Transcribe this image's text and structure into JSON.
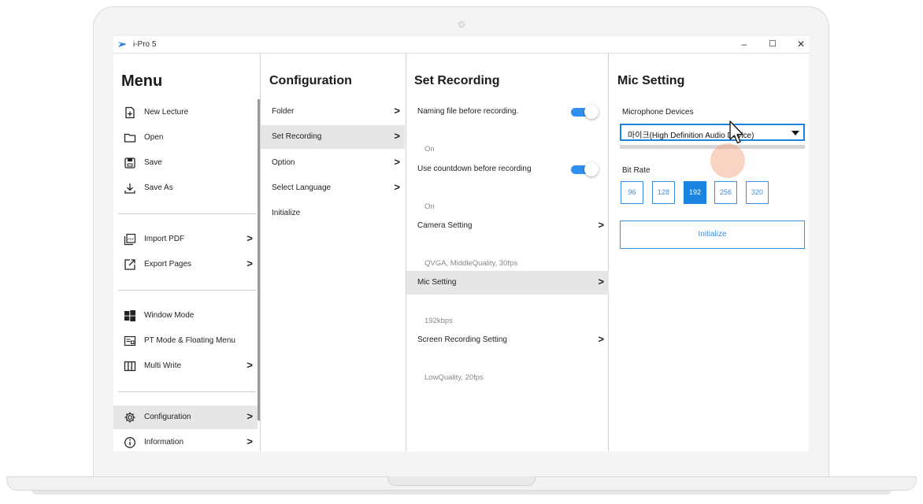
{
  "app": {
    "title": "i-Pro 5",
    "logo_icon": "ipro-logo-icon",
    "controls": {
      "minimize": "–",
      "maximize": "☐",
      "close": "✕"
    }
  },
  "menu": {
    "title": "Menu",
    "items": [
      {
        "label": "New Lecture",
        "icon": "new-file-icon"
      },
      {
        "label": "Open",
        "icon": "folder-icon"
      },
      {
        "label": "Save",
        "icon": "save-icon"
      },
      {
        "label": "Save As",
        "icon": "download-icon"
      },
      {
        "label": "Import PDF",
        "icon": "pdf-icon",
        "chevron": ">"
      },
      {
        "label": "Export Pages",
        "icon": "export-icon",
        "chevron": ">"
      },
      {
        "label": "Window Mode",
        "icon": "windows-icon"
      },
      {
        "label": "PT Mode & Floating Menu",
        "icon": "pt-mode-icon"
      },
      {
        "label": "Multi Write",
        "icon": "columns-icon",
        "chevron": ">"
      },
      {
        "label": "Configuration",
        "icon": "gear-icon",
        "chevron": ">",
        "selected": true
      },
      {
        "label": "Information",
        "icon": "info-icon",
        "chevron": ">"
      }
    ]
  },
  "configuration": {
    "title": "Configuration",
    "items": [
      {
        "label": "Folder",
        "chevron": ">"
      },
      {
        "label": "Set Recording",
        "chevron": ">",
        "selected": true
      },
      {
        "label": "Option",
        "chevron": ">"
      },
      {
        "label": "Select Language",
        "chevron": ">"
      },
      {
        "label": "Initialize"
      }
    ]
  },
  "set_recording": {
    "title": "Set Recording",
    "items": [
      {
        "label": "Naming file before recording.",
        "toggle": true,
        "sub": "On"
      },
      {
        "label": "Use countdown before recording",
        "toggle": true,
        "sub": "On"
      },
      {
        "label": "Camera Setting",
        "chevron": ">",
        "sub": "QVGA, MiddleQuality, 30fps"
      },
      {
        "label": "Mic Setting",
        "chevron": ">",
        "sub": "192kbps",
        "selected": true
      },
      {
        "label": "Screen Recording Setting",
        "chevron": ">",
        "sub": "LowQuality, 20fps"
      }
    ]
  },
  "mic_setting": {
    "title": "Mic Setting",
    "microphone_label": "Microphone Devices",
    "microphone_value": "마이크(High Definition Audio Device)",
    "level": 0,
    "bit_rate_label": "Bit Rate",
    "bit_rates": [
      "96",
      "128",
      "192",
      "256",
      "320"
    ],
    "selected_bit_rate": "192",
    "initialize_label": "Initialize"
  },
  "colors": {
    "accent": "#1a84e0",
    "toggle_on": "#2f8ff0",
    "selected_bg": "#e6e6e6"
  }
}
